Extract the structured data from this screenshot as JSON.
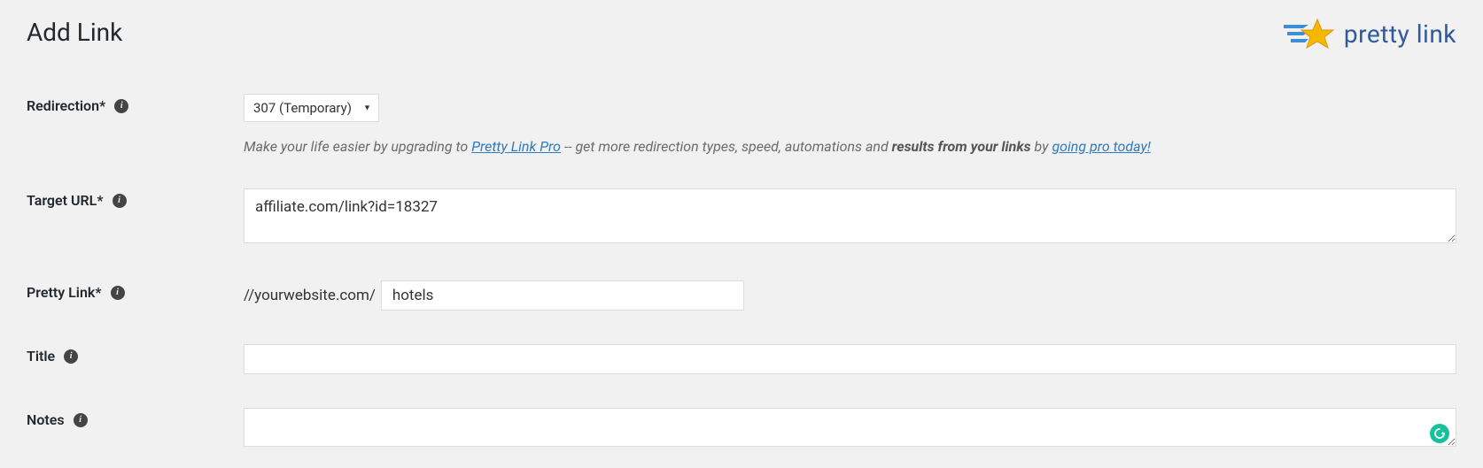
{
  "page_title": "Add Link",
  "logo_text": "pretty link",
  "fields": {
    "redirection": {
      "label": "Redirection*",
      "selected": "307 (Temporary)",
      "help_pre": "Make your life easier by upgrading to ",
      "help_link1": "Pretty Link Pro",
      "help_mid": " -- get more redirection types, speed, automations and ",
      "help_strong": "results from your links",
      "help_by": " by ",
      "help_link2": "going pro today!"
    },
    "target_url": {
      "label": "Target URL*",
      "value": "affiliate.com/link?id=18327"
    },
    "pretty_link": {
      "label": "Pretty Link*",
      "prefix": "//yourwebsite.com/",
      "value": "hotels"
    },
    "title": {
      "label": "Title",
      "value": ""
    },
    "notes": {
      "label": "Notes",
      "value": ""
    }
  }
}
